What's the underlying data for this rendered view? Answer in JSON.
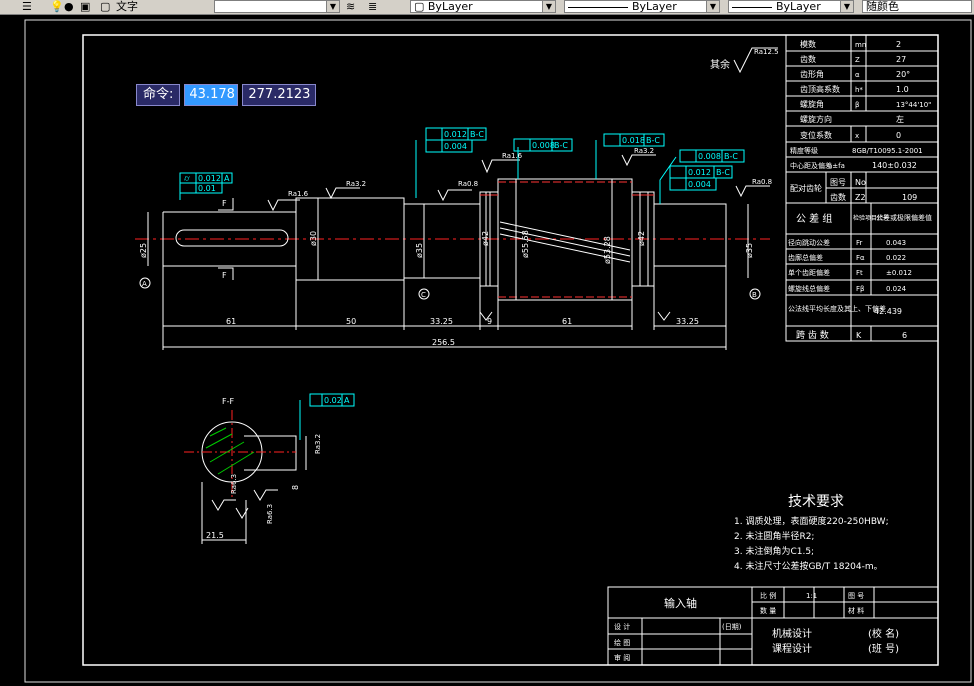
{
  "toolbar": {
    "text_style": "文字",
    "layer_color": "ByLayer",
    "linetype": "ByLayer",
    "lineweight": "ByLayer",
    "plot_style": "随颜色"
  },
  "command": {
    "label": "命令:",
    "input_x": "43.178",
    "input_y": "277.2123"
  },
  "title_block": {
    "part_name": "输入轴",
    "scale_label": "比 例",
    "scale_value": "1:1",
    "drawing_no_label": "图 号",
    "quantity_label": "数 量",
    "material_label": "材 料",
    "design_label": "设 计",
    "date_label": "(日期)",
    "drawing_label": "绘 图",
    "review_label": "审 阅",
    "course_line1": "机械设计",
    "course_line2": "课程设计",
    "school_label": "(校 名)",
    "class_label": "(班 号)"
  },
  "gear_table": {
    "rows": [
      {
        "name": "模数",
        "symbol": "mn",
        "value": "2"
      },
      {
        "name": "齿数",
        "symbol": "Z",
        "value": "27"
      },
      {
        "name": "齿形角",
        "symbol": "α",
        "value": "20°"
      },
      {
        "name": "齿顶高系数",
        "symbol": "h*",
        "value": "1.0"
      },
      {
        "name": "螺旋角",
        "symbol": "β",
        "value": "13°44'10\""
      },
      {
        "name": "螺旋方向",
        "symbol": "",
        "value": "左"
      },
      {
        "name": "变位系数",
        "symbol": "x",
        "value": "0"
      },
      {
        "name": "精度等级",
        "symbol": "",
        "value": "8GB/T10095.1-2001"
      },
      {
        "name": "中心距及偏差",
        "symbol": "a±fa",
        "value": "140±0.032"
      }
    ],
    "mating_label": "配对齿轮",
    "mating_drawing_label": "图号",
    "mating_drawing_value": "No",
    "mating_teeth_label": "齿数",
    "mating_teeth_symbol": "Z2",
    "mating_teeth_value": "109",
    "tol_group_label": "公 差 组",
    "tol_item_header": "检验项目代号",
    "tol_value_header": "公差或极限偏差值",
    "tol_rows": [
      {
        "name": "径向跳动公差",
        "symbol": "Fr",
        "value": "0.043"
      },
      {
        "name": "齿廓总偏差",
        "symbol": "Fα",
        "value": "0.022"
      },
      {
        "name": "单个齿距偏差",
        "symbol": "Ft",
        "value": "±0.012"
      },
      {
        "name": "螺旋线总偏差",
        "symbol": "Fβ",
        "value": "0.024"
      }
    ],
    "wk_label": "公法线平均长度及其上、下偏差",
    "wk_value": "42.439",
    "span_label": "跨 齿 数",
    "span_symbol": "K",
    "span_value": "6"
  },
  "tech_req": {
    "title": "技术要求",
    "items": [
      "1. 调质处理，表面硬度220-250HBW;",
      "2. 未注圆角半径R2;",
      "3. 未注倒角为C1.5;",
      "4. 未注尺寸公差按GB/T 18204-m。"
    ]
  },
  "annotations": {
    "rest_label": "其余",
    "rest_ra": "Ra12.5",
    "ra16": "Ra1.6",
    "ra32": "Ra3.2",
    "ra08": "Ra0.8",
    "ra63": "Ra6.3",
    "gdt1_tol": "0.012",
    "gdt1_datum": "A",
    "gdt1_tol2": "0.01",
    "gdt2_tol": "0.012",
    "gdt2_datum": "B-C",
    "gdt2_tol2": "0.004",
    "gdt3_tol": "0.008",
    "gdt3_datum": "B-C",
    "gdt4_tol": "0.018",
    "gdt4_datum": "B-C",
    "gdt5_tol": "0.008",
    "gdt5_datum": "B-C",
    "gdt6_tol": "0.012",
    "gdt6_datum": "B-C",
    "gdt6_tol2": "0.004",
    "gdt7_tol": "0.02",
    "gdt7_datum": "A",
    "section_label": "F-F",
    "section_mark": "F",
    "datum_a": "A",
    "datum_b": "B",
    "datum_c": "C"
  },
  "dimensions": {
    "d1": "61",
    "d2": "50",
    "d3": "33.25",
    "d4": "9",
    "d5": "61",
    "d6": "33.25",
    "total": "256.5",
    "dia_25": "ø25",
    "dia_30": "ø30",
    "dia_35a": "ø35",
    "dia_42a": "ø42",
    "dia_55": "ø55.58",
    "dia_53": "ø53.28",
    "dia_42b": "ø42",
    "dia_35b": "ø35",
    "key_depth": "21.5",
    "key_width": "8"
  }
}
